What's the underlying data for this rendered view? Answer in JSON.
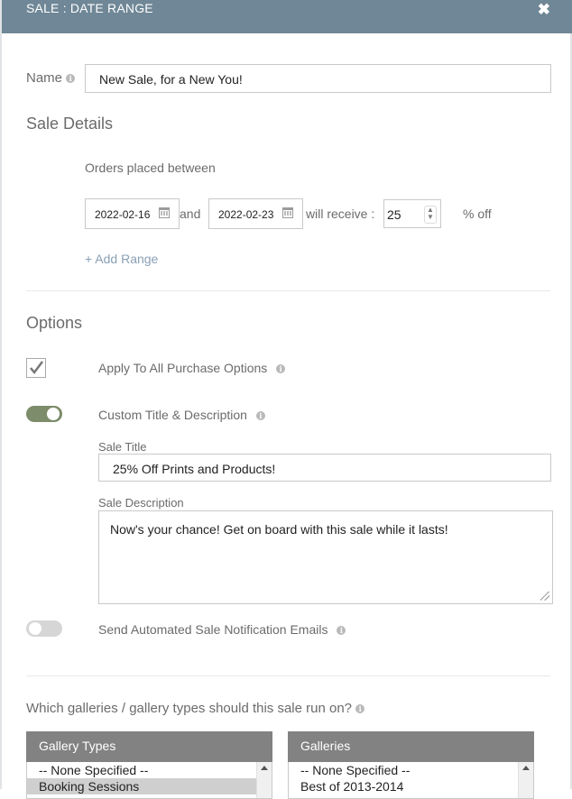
{
  "header": {
    "title": "SALE : DATE RANGE",
    "close_glyph": "✖"
  },
  "name_field": {
    "label": "Name",
    "value": "New Sale, for a New You!"
  },
  "sale_details": {
    "title": "Sale Details",
    "orders_label": "Orders placed between",
    "start_date": "2022-02-16",
    "and_label": "and",
    "end_date": "2022-02-23",
    "receive_label": "will receive :",
    "percent_value": "25",
    "percent_label": "% off",
    "add_range_label": "+ Add Range"
  },
  "options": {
    "title": "Options",
    "apply_all": {
      "label": "Apply To All Purchase Options",
      "checked": true
    },
    "custom_title": {
      "label": "Custom Title & Description",
      "enabled": true
    },
    "sale_title_label": "Sale Title",
    "sale_title_value": "25% Off Prints and Products!",
    "sale_description_label": "Sale Description",
    "sale_description_value": "Now's your chance! Get on board with this sale while it lasts!",
    "notification": {
      "label": "Send Automated Sale Notification Emails",
      "enabled": false
    }
  },
  "galleries": {
    "question": "Which galleries / gallery types should this sale run on?",
    "gallery_types": {
      "title": "Gallery Types",
      "items": [
        "-- None Specified --",
        "Booking Sessions"
      ]
    },
    "galleries_list": {
      "title": "Galleries",
      "items": [
        "-- None Specified --",
        "Best of 2013-2014"
      ]
    }
  },
  "colors": {
    "header": "#6f8796",
    "toggle_on": "#7d8c6a",
    "toggle_off": "#d6d6d6",
    "link": "#8aa0b5"
  }
}
